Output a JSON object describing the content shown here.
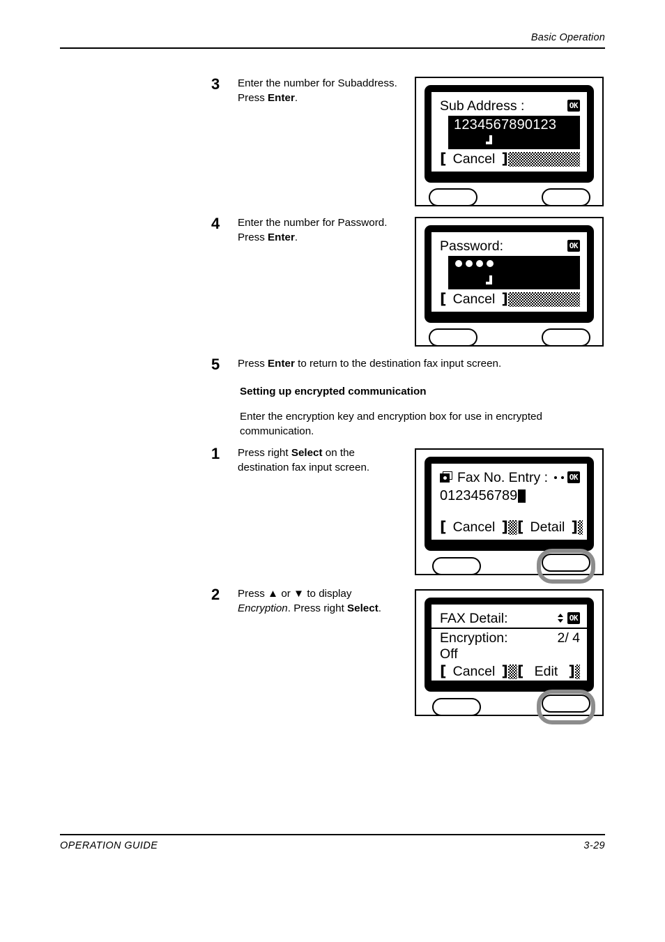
{
  "header": {
    "section_title": "Basic Operation"
  },
  "footer": {
    "guide_label": "OPERATION GUIDE",
    "page_number": "3-29"
  },
  "steps": [
    {
      "number": "3",
      "line1_a": "Enter the number for Subaddress.",
      "line2_a": "Press ",
      "line2_b": "Enter",
      "line2_c": "."
    },
    {
      "number": "4",
      "line1_a": "Enter the number for Password.",
      "line2_a": "Press ",
      "line2_b": "Enter",
      "line2_c": "."
    },
    {
      "number": "5",
      "line1_a": "Press ",
      "line1_b": "Enter",
      "line1_c": " to return to the destination fax input screen."
    },
    {
      "number": "1",
      "line1_a": "Press right ",
      "line1_b": "Select",
      "line1_c": " on the",
      "line2_a": "destination fax input screen."
    },
    {
      "number": "2",
      "line1_a": "Press ",
      "line1_arrow_up": "▲",
      "line1_b": " or ",
      "line1_arrow_down": "▼",
      "line1_c": " to display",
      "line2_a": "Encryption",
      "line2_b": ". Press right ",
      "line2_c": "Select",
      "line2_d": "."
    }
  ],
  "section": {
    "heading": "Setting up encrypted communication",
    "paragraph_line1": "Enter the encryption key and encryption box for use in encrypted",
    "paragraph_line2": "communication."
  },
  "panels": [
    {
      "id": "sub-address",
      "title": "Sub Address :",
      "ok_badge": "OK",
      "entry_value": "1234567890123",
      "softkeys": [
        {
          "label": "Cancel"
        }
      ]
    },
    {
      "id": "password",
      "title": "Password:",
      "ok_badge": "OK",
      "masked_dots": 4,
      "softkeys": [
        {
          "label": "Cancel"
        }
      ]
    },
    {
      "id": "fax-no-entry",
      "title": "Fax No. Entry :",
      "icon": "fax-stack-icon",
      "ok_badge": "OK",
      "entry_value": "0123456789",
      "softkeys": [
        {
          "label": "Cancel"
        },
        {
          "label": "Detail"
        }
      ],
      "selected_key": "right"
    },
    {
      "id": "fax-detail",
      "title": "FAX Detail:",
      "ok_badge": "OK",
      "setting_label": "Encryption:",
      "setting_value": "Off",
      "page_counter": "2/ 4",
      "softkeys": [
        {
          "label": "Cancel"
        },
        {
          "label": "Edit"
        }
      ],
      "selected_key": "right"
    }
  ],
  "colors": {
    "ink": "#000000",
    "paper": "#ffffff",
    "selection_ring": "#8c8c8c"
  }
}
